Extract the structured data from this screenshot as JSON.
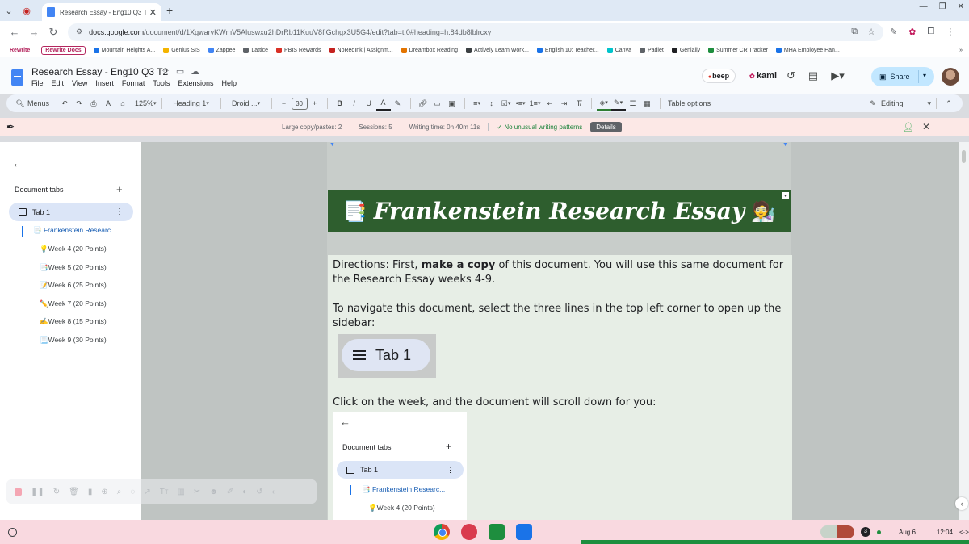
{
  "browser": {
    "tab_title": "Research Essay - Eng10 Q3 T2",
    "url_host": "docs.google.com",
    "url_path": "/document/d/1XgwarvKWmV5Aluswxu2hDrRb11KuuV8flGchgx3U5G4/edit?tab=t.0#heading=h.84db8lblrcxy"
  },
  "bookmarks": [
    {
      "label": "Rewrite",
      "style": "pill"
    },
    {
      "label": "Rewrite Docs",
      "style": "pill-outline"
    },
    {
      "label": "Mountain Heights A...",
      "color": "#1a73e8"
    },
    {
      "label": "Genius SIS",
      "color": "#f4b400"
    },
    {
      "label": "Zappee",
      "color": "#4285f4"
    },
    {
      "label": "Lattice",
      "color": "#5f6368"
    },
    {
      "label": "PBIS Rewards",
      "color": "#d93025"
    },
    {
      "label": "NoRedInk | Assignm...",
      "color": "#c5221f"
    },
    {
      "label": "Dreambox Reading",
      "color": "#e37400"
    },
    {
      "label": "Actively Learn Work...",
      "color": "#3c4043"
    },
    {
      "label": "English 10: Teacher...",
      "color": "#1a73e8"
    },
    {
      "label": "Canva",
      "color": "#00c4cc"
    },
    {
      "label": "Padlet",
      "color": "#5f6368"
    },
    {
      "label": "Genially",
      "color": "#202124"
    },
    {
      "label": "Summer CR Tracker",
      "color": "#1e8e3e"
    },
    {
      "label": "MHA Employee Han...",
      "color": "#1a73e8"
    }
  ],
  "docs": {
    "title": "Research Essay - Eng10 Q3 T2",
    "menu": [
      "File",
      "Edit",
      "View",
      "Insert",
      "Format",
      "Tools",
      "Extensions",
      "Help"
    ],
    "beep_label": "beep",
    "kami_label": "kami",
    "share_label": "Share"
  },
  "toolbar": {
    "menus_label": "Menus",
    "zoom": "125%",
    "style": "Heading 1",
    "font": "Droid ...",
    "font_size": "30",
    "table_options": "Table options",
    "mode": "Editing"
  },
  "infobar": {
    "copy_pastes": "Large copy/pastes: 2",
    "sessions": "Sessions: 5",
    "writing_time": "Writing time: 0h 40m 11s",
    "patterns": "✓ No unusual writing patterns",
    "details": "Details"
  },
  "sidebar": {
    "header": "Document tabs",
    "tab_label": "Tab 1",
    "items": [
      "📑 Frankenstein Researc...",
      "💡Week 4 (20 Points)",
      "📑Week 5 (20 Points)",
      "📝Week 6 (25 Points)",
      "✏️Week 7 (20 Points)",
      "✍️Week 8 (15 Points)",
      "📃Week 9 (30 Points)"
    ]
  },
  "document": {
    "banner_emoji_left": "📑",
    "banner_title": "Frankenstein Research Essay",
    "banner_emoji_right": "🧑‍🔬",
    "directions_lead": "Directions: First, ",
    "directions_bold": "make a copy",
    "directions_rest": " of this document. You will use this same document for the Research Essay weeks 4-9.",
    "navigate_text": "To navigate this document, select the three lines in the top left corner to open up the sidebar:",
    "tab_image_label": "Tab 1",
    "click_text": "Click on the week, and the document will scroll down for you:",
    "embedded_sidebar": {
      "header": "Document tabs",
      "tab_label": "Tab 1",
      "item1": "📑 Frankenstein Researc...",
      "item2": "💡Week 4 (20 Points)"
    }
  },
  "shelf": {
    "notification_count": "3",
    "date": "Aug 6",
    "time": "12:04"
  }
}
